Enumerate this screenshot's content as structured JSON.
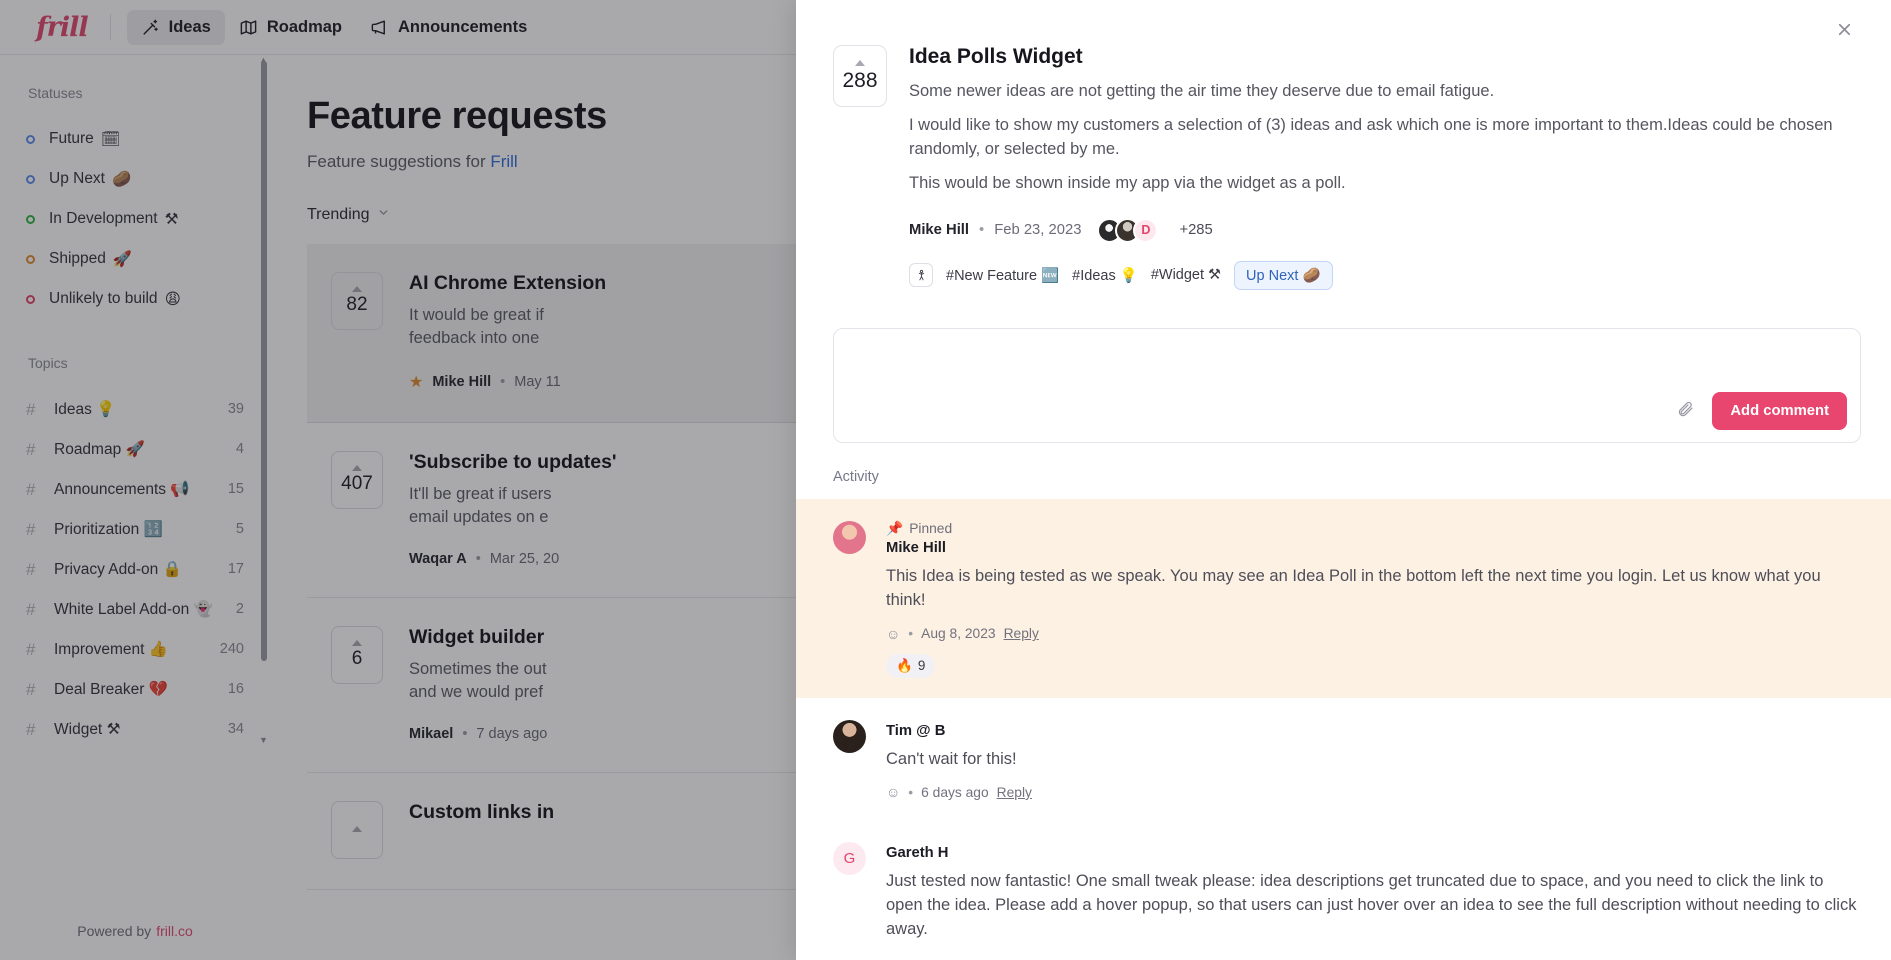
{
  "topbar": {
    "brand": "frill",
    "nav": [
      {
        "label": "Ideas",
        "icon": "magic-wand-icon",
        "active": true
      },
      {
        "label": "Roadmap",
        "icon": "map-icon",
        "active": false
      },
      {
        "label": "Announcements",
        "icon": "megaphone-icon",
        "active": false
      }
    ]
  },
  "sidebar": {
    "statuses_heading": "Statuses",
    "statuses": [
      {
        "label": "Future",
        "emoji": "🗓",
        "color": "#5b8def"
      },
      {
        "label": "Up Next",
        "emoji": "🥔",
        "color": "#5b8def"
      },
      {
        "label": "In Development",
        "emoji": "⚒",
        "color": "#2fb344"
      },
      {
        "label": "Shipped",
        "emoji": "🚀",
        "color": "#e08a2e"
      },
      {
        "label": "Unlikely to build",
        "emoji": "😩",
        "color": "#e2436c"
      }
    ],
    "topics_heading": "Topics",
    "topics": [
      {
        "label": "Ideas",
        "emoji": "💡",
        "count": "39"
      },
      {
        "label": "Roadmap",
        "emoji": "🚀",
        "count": "4"
      },
      {
        "label": "Announcements",
        "emoji": "📢",
        "count": "15"
      },
      {
        "label": "Prioritization",
        "emoji": "🔢",
        "count": "5"
      },
      {
        "label": "Privacy Add-on",
        "emoji": "🔒",
        "count": "17"
      },
      {
        "label": "White Label Add-on",
        "emoji": "👻",
        "count": "2"
      },
      {
        "label": "Improvement",
        "emoji": "👍",
        "count": "240"
      },
      {
        "label": "Deal Breaker",
        "emoji": "💔",
        "count": "16"
      },
      {
        "label": "Widget",
        "emoji": "⚒",
        "count": "34"
      }
    ],
    "footer": {
      "text": "Powered by",
      "link": "frill.co"
    }
  },
  "main": {
    "title": "Feature requests",
    "subtitle_prefix": "Feature suggestions for ",
    "subtitle_link": "Frill",
    "sort_label": "Trending",
    "ideas": [
      {
        "votes": "82",
        "title": "AI Chrome Extension",
        "desc_line1": "It would be great if",
        "desc_line2": "feedback into one",
        "author": "Mike Hill",
        "date": "May 11",
        "starred": true,
        "highlight": true
      },
      {
        "votes": "407",
        "title": "'Subscribe to updates'",
        "desc_line1": "It'll be great if users",
        "desc_line2": "email updates on e",
        "author": "Waqar A",
        "date": "Mar 25, 20",
        "starred": false,
        "highlight": false
      },
      {
        "votes": "6",
        "title": "Widget builder",
        "desc_line1": "Sometimes the out",
        "desc_line2": "and we would pref",
        "author": "Mikael",
        "date": "7 days ago",
        "starred": false,
        "highlight": false
      },
      {
        "votes": "",
        "title": "Custom links in",
        "desc_line1": "",
        "desc_line2": "",
        "author": "",
        "date": "",
        "starred": false,
        "highlight": false
      }
    ]
  },
  "panel": {
    "close_icon": "close-icon",
    "votes": "288",
    "title": "Idea Polls Widget",
    "paragraphs": [
      "Some newer ideas are not getting the air time they deserve due to email fatigue.",
      "I would like to show my customers a selection of (3) ideas and ask which one is more important to them.Ideas could be chosen randomly, or selected by me.",
      "This would be shown inside my app via the widget as a poll."
    ],
    "author": "Mike Hill",
    "date": "Feb 23, 2023",
    "avatar_extra": "+285",
    "avatar_initial": "D",
    "tags": [
      {
        "label": "#New Feature",
        "emoji": "🆕"
      },
      {
        "label": "#Ideas",
        "emoji": "💡"
      },
      {
        "label": "#Widget",
        "emoji": "⚒"
      }
    ],
    "status_pill": "Up Next 🥔",
    "comment_placeholder": "",
    "comment_value": "",
    "add_comment_label": "Add comment",
    "attach_icon": "paperclip-icon",
    "activity_label": "Activity",
    "comments": [
      {
        "pinned": true,
        "pinned_label": "Pinned",
        "pinned_emoji": "📌",
        "name": "Mike Hill",
        "text": "This Idea is being tested as we speak. You may see an Idea Poll in the bottom left the next time you login. Let us know what you think!",
        "date": "Aug 8, 2023",
        "reply_label": "Reply",
        "reaction_emoji": "🔥",
        "reaction_count": "9",
        "avatar_class": "mike",
        "avatar_initial": ""
      },
      {
        "pinned": false,
        "pinned_label": "",
        "pinned_emoji": "",
        "name": "Tim @ B",
        "text": "Can't wait for this!",
        "date": "6 days ago",
        "reply_label": "Reply",
        "reaction_emoji": "",
        "reaction_count": "",
        "avatar_class": "tim",
        "avatar_initial": ""
      },
      {
        "pinned": false,
        "pinned_label": "",
        "pinned_emoji": "",
        "name": "Gareth H",
        "text": "Just tested now fantastic! One small tweak please: idea descriptions get truncated due to space, and you need to click the link to open the idea. Please add a hover popup, so that users can just hover over an idea to see the full description without needing to click away.",
        "date": "",
        "reply_label": "",
        "reaction_emoji": "",
        "reaction_count": "",
        "avatar_class": "gareth",
        "avatar_initial": "G"
      }
    ]
  }
}
